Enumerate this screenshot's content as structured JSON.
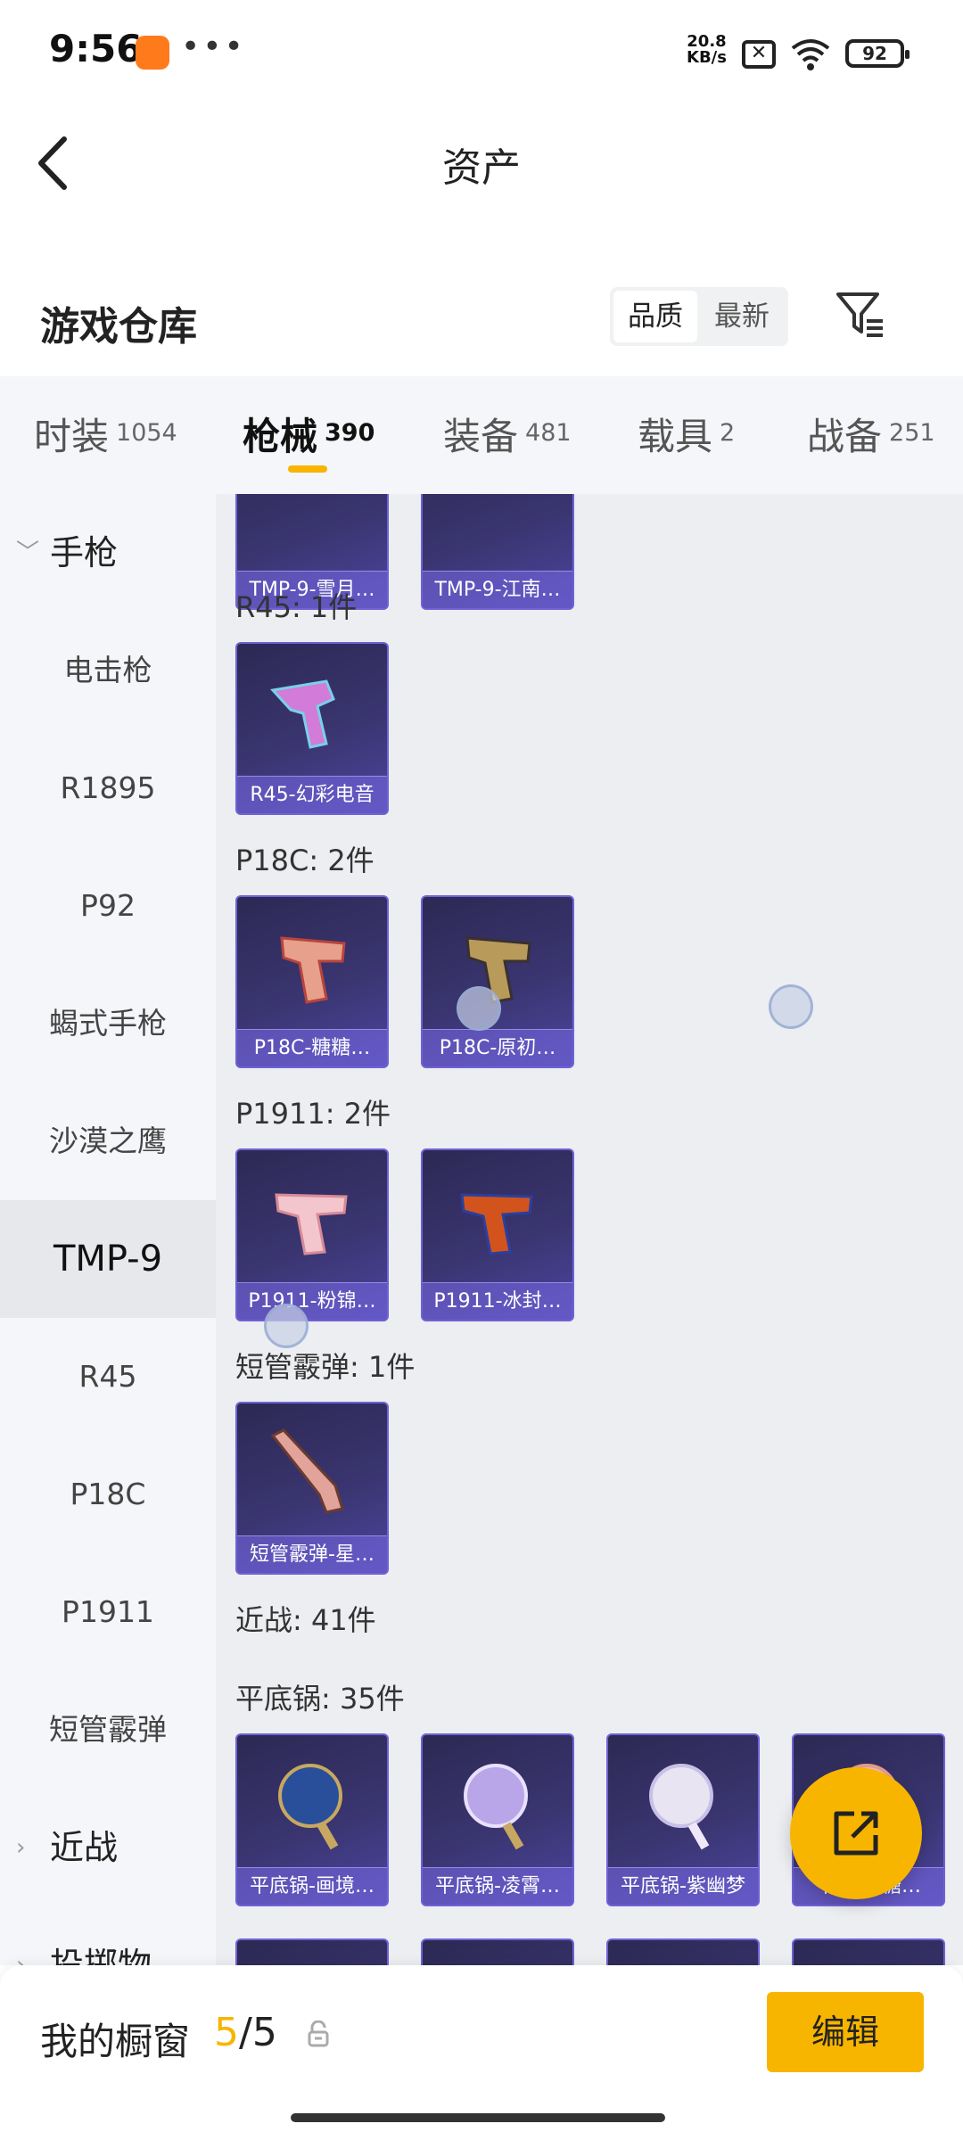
{
  "status_bar": {
    "time": "9:56",
    "net_speed_value": "20.8",
    "net_speed_unit": "KB/s",
    "battery": "92"
  },
  "header": {
    "title": "资产",
    "section_title": "游戏仓库",
    "sort_options": [
      "品质",
      "最新"
    ],
    "sort_selected": "品质"
  },
  "tabs": [
    {
      "label": "时装",
      "count": "1054"
    },
    {
      "label": "枪械",
      "count": "390",
      "active": true
    },
    {
      "label": "装备",
      "count": "481"
    },
    {
      "label": "载具",
      "count": "2"
    },
    {
      "label": "战备",
      "count": "251"
    }
  ],
  "sidebar": {
    "items": [
      {
        "label": "手枪",
        "type": "group",
        "expanded": true
      },
      {
        "label": "电击枪"
      },
      {
        "label": "R1895"
      },
      {
        "label": "P92"
      },
      {
        "label": "蝎式手枪"
      },
      {
        "label": "沙漠之鹰"
      },
      {
        "label": "TMP-9",
        "active": true
      },
      {
        "label": "R45"
      },
      {
        "label": "P18C"
      },
      {
        "label": "P1911"
      },
      {
        "label": "短管霰弹"
      },
      {
        "label": "近战",
        "type": "group",
        "expanded": false
      },
      {
        "label": "投掷物",
        "type": "group",
        "expanded": false
      }
    ]
  },
  "content": {
    "top_cards": [
      {
        "name": "TMP-9-雪月…"
      },
      {
        "name": "TMP-9-江南…"
      }
    ],
    "groups": [
      {
        "label": "R45: 1件",
        "items": [
          {
            "name": "R45-幻彩电音"
          }
        ]
      },
      {
        "label": "P18C: 2件",
        "items": [
          {
            "name": "P18C-糖糖…"
          },
          {
            "name": "P18C-原初…"
          }
        ]
      },
      {
        "label": "P1911: 2件",
        "items": [
          {
            "name": "P1911-粉锦…"
          },
          {
            "name": "P1911-冰封…"
          }
        ]
      },
      {
        "label": "短管霰弹: 1件",
        "items": [
          {
            "name": "短管霰弹-星…"
          }
        ]
      },
      {
        "label": "近战: 41件",
        "items": []
      },
      {
        "label": "平底锅: 35件",
        "items": [
          {
            "name": "平底锅-画境…"
          },
          {
            "name": "平底锅-凌霄…"
          },
          {
            "name": "平底锅-紫幽梦"
          },
          {
            "name": "平底锅-糖…"
          }
        ]
      }
    ]
  },
  "bottom_bar": {
    "label": "我的橱窗",
    "count_current": "5",
    "count_sep": "/",
    "count_total": "5",
    "edit_label": "编辑"
  },
  "colors": {
    "accent": "#f7b500",
    "card_bg": "#3a3570",
    "card_border": "#6f62d6"
  },
  "icons": [
    "back-arrow-icon",
    "filter-icon",
    "lock-icon",
    "share-external-icon",
    "chevron-down-icon",
    "chevron-right-icon",
    "wifi-icon",
    "battery-icon"
  ]
}
